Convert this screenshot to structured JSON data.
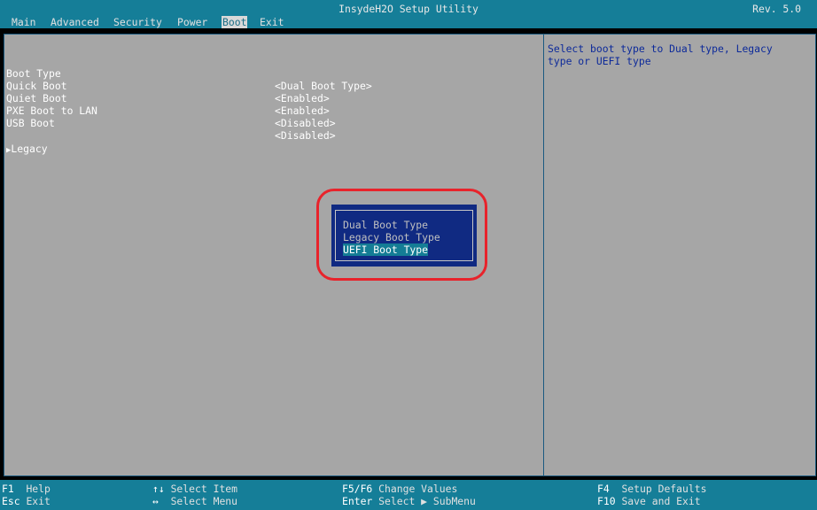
{
  "header": {
    "title": "InsydeH2O Setup Utility",
    "revision": "Rev. 5.0",
    "tabs": [
      "Main",
      "Advanced",
      "Security",
      "Power",
      "Boot",
      "Exit"
    ],
    "active_tab": "Boot"
  },
  "settings": [
    {
      "label": "Boot Type",
      "value": "<Dual Boot Type>"
    },
    {
      "label": "Quick Boot",
      "value": "<Enabled>"
    },
    {
      "label": "Quiet Boot",
      "value": "<Enabled>"
    },
    {
      "label": "PXE Boot to LAN",
      "value": "<Disabled>"
    },
    {
      "label": "USB Boot",
      "value": "<Disabled>"
    }
  ],
  "submenu": {
    "label": "Legacy",
    "icon": "right-triangle-icon",
    "glyph": "▶"
  },
  "help_text": "Select boot type to Dual type, Legacy\ntype or UEFI type",
  "popup": {
    "options": [
      "Dual Boot Type",
      "Legacy Boot Type",
      "UEFI Boot Type"
    ],
    "selected_option": "UEFI Boot Type"
  },
  "footer": {
    "keys": [
      {
        "key": "F1",
        "action": "Help"
      },
      {
        "key": "Esc",
        "action": "Exit"
      },
      {
        "key": "↑↓",
        "action": "Select Item"
      },
      {
        "key": "↔",
        "action": "Select Menu"
      },
      {
        "key": "F5/F6",
        "action": "Change Values"
      },
      {
        "key": "Enter",
        "action": "Select ▶ SubMenu"
      },
      {
        "key": "F4",
        "action": "Setup Defaults"
      },
      {
        "key": "F10",
        "action": "Save and Exit"
      }
    ]
  },
  "colors": {
    "bar": "#157e98",
    "panel": "#a6a6a6",
    "popup_bg": "#102a82",
    "help_text": "#0d2a9a",
    "annotation_ring": "#e8232b"
  }
}
